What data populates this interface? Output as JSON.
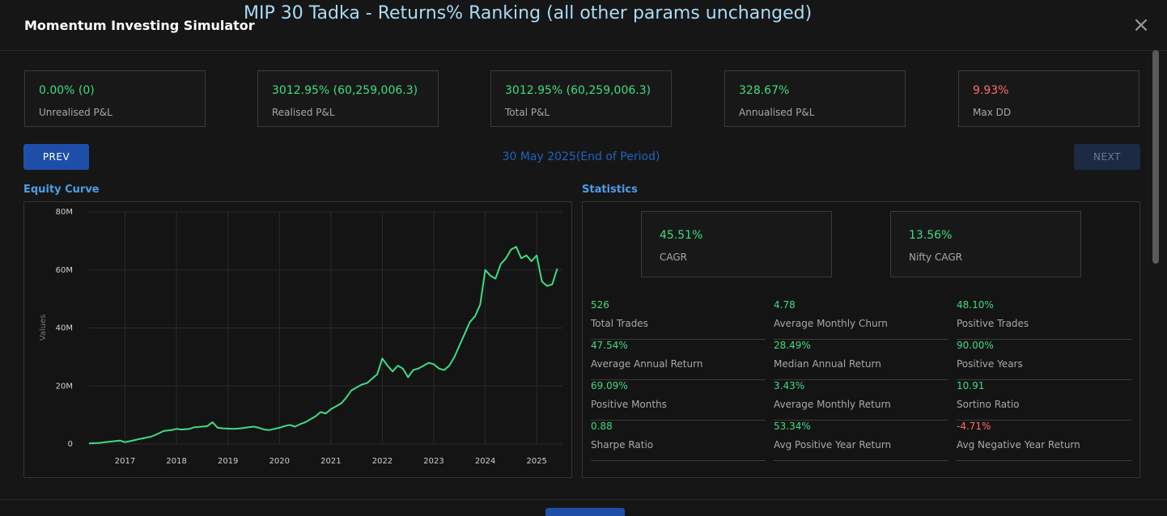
{
  "header": {
    "app_title": "Momentum Investing Simulator",
    "overlay_title": "MIP 30 Tadka - Returns% Ranking (all other params unchanged)",
    "close_icon": "×"
  },
  "summary": [
    {
      "value": "0.00% (0)",
      "label": "Unrealised P&L",
      "color": "#3ddc84"
    },
    {
      "value": "3012.95% (60,259,006.3)",
      "label": "Realised P&L",
      "color": "#3ddc84"
    },
    {
      "value": "3012.95% (60,259,006.3)",
      "label": "Total P&L",
      "color": "#3ddc84"
    },
    {
      "value": "328.67%",
      "label": "Annualised P&L",
      "color": "#3ddc84"
    },
    {
      "value": "9.93%",
      "label": "Max DD",
      "color": "#ff6b6b"
    }
  ],
  "nav": {
    "prev_label": "PREV",
    "next_label": "NEXT",
    "period_label": "30 May 2025(End of Period)"
  },
  "equity": {
    "section_title": "Equity Curve"
  },
  "statistics": {
    "section_title": "Statistics",
    "cagr": {
      "value": "45.51%",
      "label": "CAGR"
    },
    "nifty_cagr": {
      "value": "13.56%",
      "label": "Nifty CAGR"
    },
    "metrics": [
      {
        "value": "526",
        "label": "Total Trades"
      },
      {
        "value": "4.78",
        "label": "Average Monthly Churn"
      },
      {
        "value": "48.10%",
        "label": "Positive Trades"
      },
      {
        "value": "47.54%",
        "label": "Average Annual Return"
      },
      {
        "value": "28.49%",
        "label": "Median Annual Return"
      },
      {
        "value": "90.00%",
        "label": "Positive Years"
      },
      {
        "value": "69.09%",
        "label": "Positive Months"
      },
      {
        "value": "3.43%",
        "label": "Average Monthly Return"
      },
      {
        "value": "10.91",
        "label": "Sortino Ratio"
      },
      {
        "value": "0.88",
        "label": "Sharpe Ratio"
      },
      {
        "value": "53.34%",
        "label": "Avg Positive Year Return"
      },
      {
        "value": "-4.71%",
        "label": "Avg Negative Year Return",
        "negative": true
      }
    ]
  },
  "chart_data": {
    "type": "line",
    "title": "",
    "xlabel": "",
    "ylabel": "Values",
    "xlim": [
      2016.3,
      2025.5
    ],
    "ylim": [
      0,
      80
    ],
    "y_ticks": [
      0,
      20,
      40,
      60,
      80
    ],
    "y_tick_labels": [
      "0",
      "20M",
      "40M",
      "60M",
      "80M"
    ],
    "x_ticks": [
      2017,
      2018,
      2019,
      2020,
      2021,
      2022,
      2023,
      2024,
      2025
    ],
    "x_tick_labels": [
      "2017",
      "2018",
      "2019",
      "2020",
      "2021",
      "2022",
      "2023",
      "2024",
      "2025"
    ],
    "grid": true,
    "line_color": "#3ddc84",
    "series": [
      {
        "x": [
          2016.3,
          2016.5,
          2016.7,
          2016.9,
          2017.0,
          2017.1,
          2017.2,
          2017.3,
          2017.5,
          2017.6,
          2017.75,
          2017.9,
          2018.0,
          2018.1,
          2018.25,
          2018.35,
          2018.5,
          2018.6,
          2018.7,
          2018.8,
          2018.9,
          2019.0,
          2019.1,
          2019.25,
          2019.4,
          2019.5,
          2019.6,
          2019.7,
          2019.8,
          2019.9,
          2020.0,
          2020.1,
          2020.2,
          2020.3,
          2020.4,
          2020.5,
          2020.6,
          2020.7,
          2020.8,
          2020.9,
          2021.0,
          2021.1,
          2021.2,
          2021.3,
          2021.4,
          2021.5,
          2021.6,
          2021.7,
          2021.8,
          2021.9,
          2022.0,
          2022.1,
          2022.2,
          2022.3,
          2022.4,
          2022.5,
          2022.6,
          2022.7,
          2022.8,
          2022.9,
          2023.0,
          2023.1,
          2023.2,
          2023.3,
          2023.4,
          2023.5,
          2023.6,
          2023.7,
          2023.8,
          2023.9,
          2024.0,
          2024.1,
          2024.2,
          2024.3,
          2024.4,
          2024.5,
          2024.6,
          2024.7,
          2024.8,
          2024.9,
          2025.0,
          2025.1,
          2025.2,
          2025.3,
          2025.4
        ],
        "y": [
          0.2,
          0.4,
          0.8,
          1.2,
          0.6,
          1.0,
          1.4,
          1.8,
          2.5,
          3.2,
          4.5,
          4.8,
          5.2,
          5.0,
          5.2,
          5.8,
          6.0,
          6.2,
          7.5,
          5.6,
          5.4,
          5.3,
          5.2,
          5.4,
          5.8,
          6.0,
          5.6,
          5.0,
          4.8,
          5.2,
          5.6,
          6.2,
          6.6,
          6.0,
          6.8,
          7.5,
          8.5,
          9.5,
          11.0,
          10.5,
          12.0,
          13.0,
          14.0,
          16.0,
          18.5,
          19.5,
          20.5,
          21.0,
          22.5,
          24.0,
          29.5,
          27.0,
          25.0,
          27.0,
          26.0,
          23.0,
          25.5,
          26.0,
          27.0,
          28.0,
          27.5,
          26.0,
          25.5,
          27.0,
          30.0,
          34.0,
          38.0,
          42.0,
          44.0,
          48.0,
          60.0,
          58.0,
          57.0,
          62.0,
          64.0,
          67.0,
          68.0,
          64.0,
          65.0,
          63.0,
          65.0,
          56.0,
          54.5,
          55.0,
          60.5
        ]
      }
    ]
  }
}
